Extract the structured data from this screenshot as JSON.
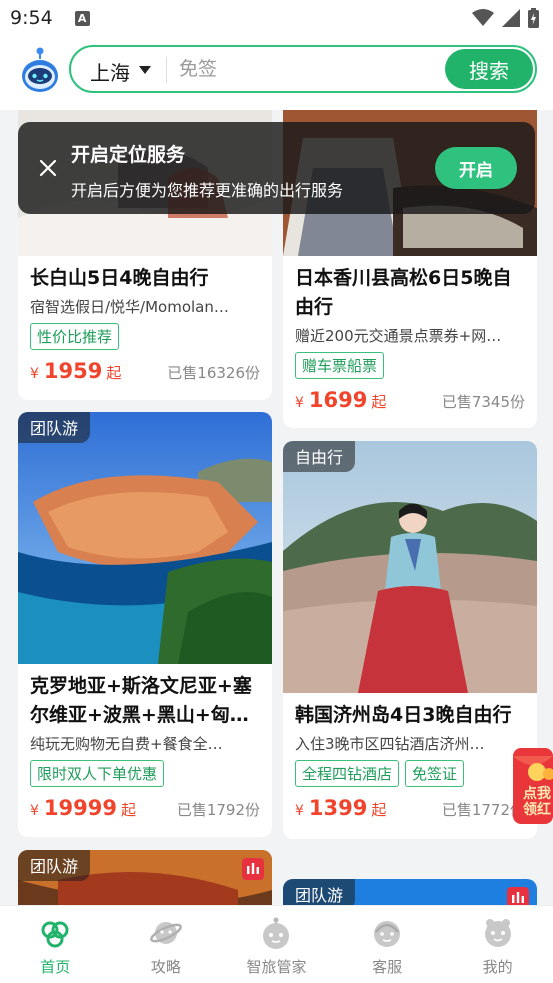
{
  "status_bar": {
    "time": "9:54",
    "notification_icon": "A"
  },
  "header": {
    "city": "上海",
    "search_placeholder": "免签",
    "search_button": "搜索"
  },
  "location_banner": {
    "title": "开启定位服务",
    "description": "开启后方便为您推荐更准确的出行服务",
    "enable_button": "开启"
  },
  "cards": [
    {
      "title": "长白山5日4晚自由行",
      "subtitle": "宿智选假日/悦华/Momolan…",
      "tags": [
        "性价比推荐"
      ],
      "price_symbol": "¥",
      "price": "1959",
      "price_suffix": "起",
      "sold": "已售16326份"
    },
    {
      "title": "日本香川县高松6日5晚自由行",
      "subtitle": "赠近200元交通景点票券+网…",
      "tags": [
        "赠车票船票"
      ],
      "price_symbol": "¥",
      "price": "1699",
      "price_suffix": "起",
      "sold": "已售7345份"
    },
    {
      "type_tag": "团队游",
      "title": "克罗地亚+斯洛文尼亚+塞尔维亚+波黑+黑山+匈…",
      "subtitle": "纯玩无购物无自费+餐食全…",
      "tags": [
        "限时双人下单优惠"
      ],
      "price_symbol": "¥",
      "price": "19999",
      "price_suffix": "起",
      "sold": "已售1792份"
    },
    {
      "type_tag": "自由行",
      "title": "韩国济州岛4日3晚自由行",
      "subtitle": "入住3晚市区四钻酒店济州…",
      "tags": [
        "全程四钻酒店",
        "免签证"
      ],
      "price_symbol": "¥",
      "price": "1399",
      "price_suffix": "起",
      "sold": "已售1772份"
    },
    {
      "type_tag": "团队游"
    },
    {
      "type_tag": "团队游"
    }
  ],
  "red_packet": {
    "text": "点我领红"
  },
  "bottom_nav": [
    {
      "label": "首页",
      "icon": "home-icon",
      "active": true
    },
    {
      "label": "攻略",
      "icon": "planet-icon",
      "active": false
    },
    {
      "label": "智旅管家",
      "icon": "robot-icon",
      "active": false
    },
    {
      "label": "客服",
      "icon": "headset-icon",
      "active": false
    },
    {
      "label": "我的",
      "icon": "profile-icon",
      "active": false
    }
  ],
  "colors": {
    "brand_green": "#22b36a",
    "price_red": "#f0452c"
  }
}
